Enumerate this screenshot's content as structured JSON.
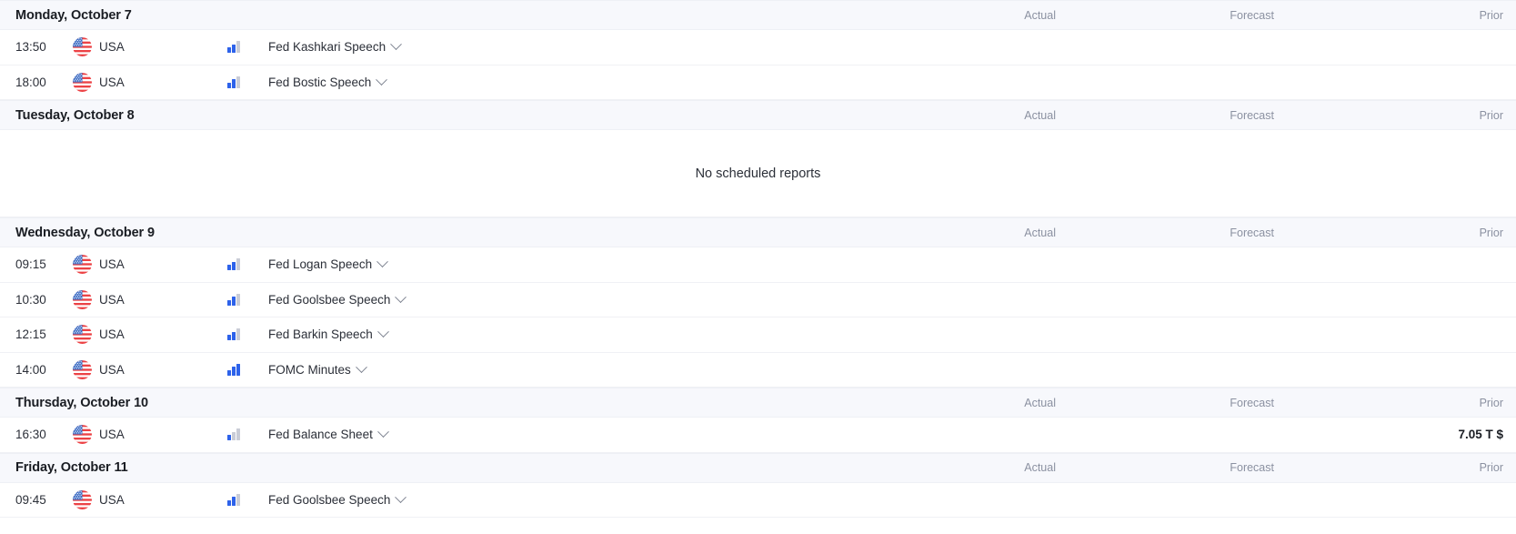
{
  "columns": {
    "actual": "Actual",
    "forecast": "Forecast",
    "prior": "Prior"
  },
  "empty_message": "No scheduled reports",
  "colors": {
    "impact_active": "#2d62ea",
    "impact_inactive": "#c9ccd6",
    "header_bg": "#f7f8fc"
  },
  "icons": {
    "impact": "impact-bars-icon",
    "flag": "usa-flag-icon",
    "expand": "chevron-down-icon"
  },
  "days": [
    {
      "date": "Monday, October 7",
      "empty": false,
      "events": [
        {
          "time": "13:50",
          "country": "USA",
          "impact": 2,
          "name": "Fed Kashkari Speech",
          "actual": "",
          "forecast": "",
          "prior": ""
        },
        {
          "time": "18:00",
          "country": "USA",
          "impact": 2,
          "name": "Fed Bostic Speech",
          "actual": "",
          "forecast": "",
          "prior": ""
        }
      ]
    },
    {
      "date": "Tuesday, October 8",
      "empty": true,
      "events": []
    },
    {
      "date": "Wednesday, October 9",
      "empty": false,
      "events": [
        {
          "time": "09:15",
          "country": "USA",
          "impact": 2,
          "name": "Fed Logan Speech",
          "actual": "",
          "forecast": "",
          "prior": ""
        },
        {
          "time": "10:30",
          "country": "USA",
          "impact": 2,
          "name": "Fed Goolsbee Speech",
          "actual": "",
          "forecast": "",
          "prior": ""
        },
        {
          "time": "12:15",
          "country": "USA",
          "impact": 2,
          "name": "Fed Barkin Speech",
          "actual": "",
          "forecast": "",
          "prior": ""
        },
        {
          "time": "14:00",
          "country": "USA",
          "impact": 3,
          "name": "FOMC Minutes",
          "actual": "",
          "forecast": "",
          "prior": ""
        }
      ]
    },
    {
      "date": "Thursday, October 10",
      "empty": false,
      "events": [
        {
          "time": "16:30",
          "country": "USA",
          "impact": 1,
          "name": "Fed Balance Sheet",
          "actual": "",
          "forecast": "",
          "prior": "7.05 T $"
        }
      ]
    },
    {
      "date": "Friday, October 11",
      "empty": false,
      "events": [
        {
          "time": "09:45",
          "country": "USA",
          "impact": 2,
          "name": "Fed Goolsbee Speech",
          "actual": "",
          "forecast": "",
          "prior": ""
        }
      ]
    }
  ]
}
